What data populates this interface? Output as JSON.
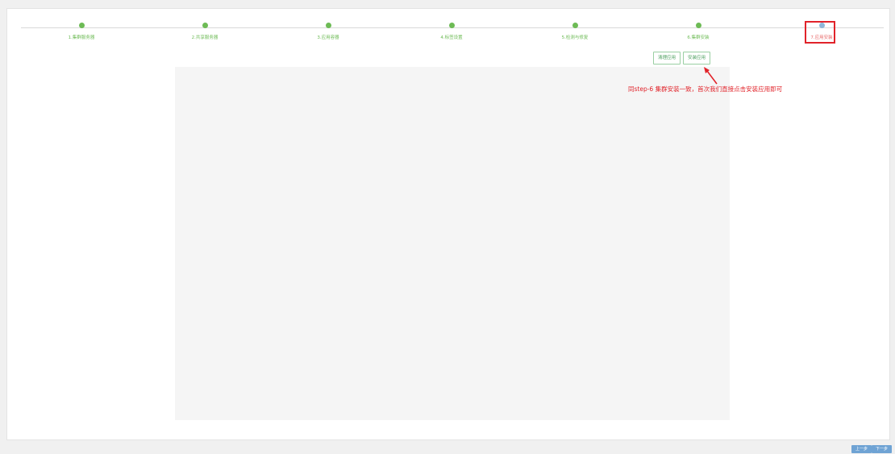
{
  "steps": [
    {
      "label": "1.集群服务器"
    },
    {
      "label": "2.共享服务器"
    },
    {
      "label": "3.应用容器"
    },
    {
      "label": "4.标签设置"
    },
    {
      "label": "5.检测与修复"
    },
    {
      "label": "6.集群安装"
    },
    {
      "label": "7.应用安装"
    }
  ],
  "active_step": 7,
  "actions": {
    "clean_label": "清理应用",
    "install_label": "安装应用"
  },
  "annotation": {
    "text": "同step-6 集群安装一致，首次我们直接点击安装应用即可"
  },
  "nav": {
    "prev_label": "上一步",
    "next_label": "下一步"
  },
  "colors": {
    "completed": "#6dbb55",
    "active": "#8fb6d8",
    "annotation": "#e1232a",
    "nav_button": "#6fa3d4"
  }
}
